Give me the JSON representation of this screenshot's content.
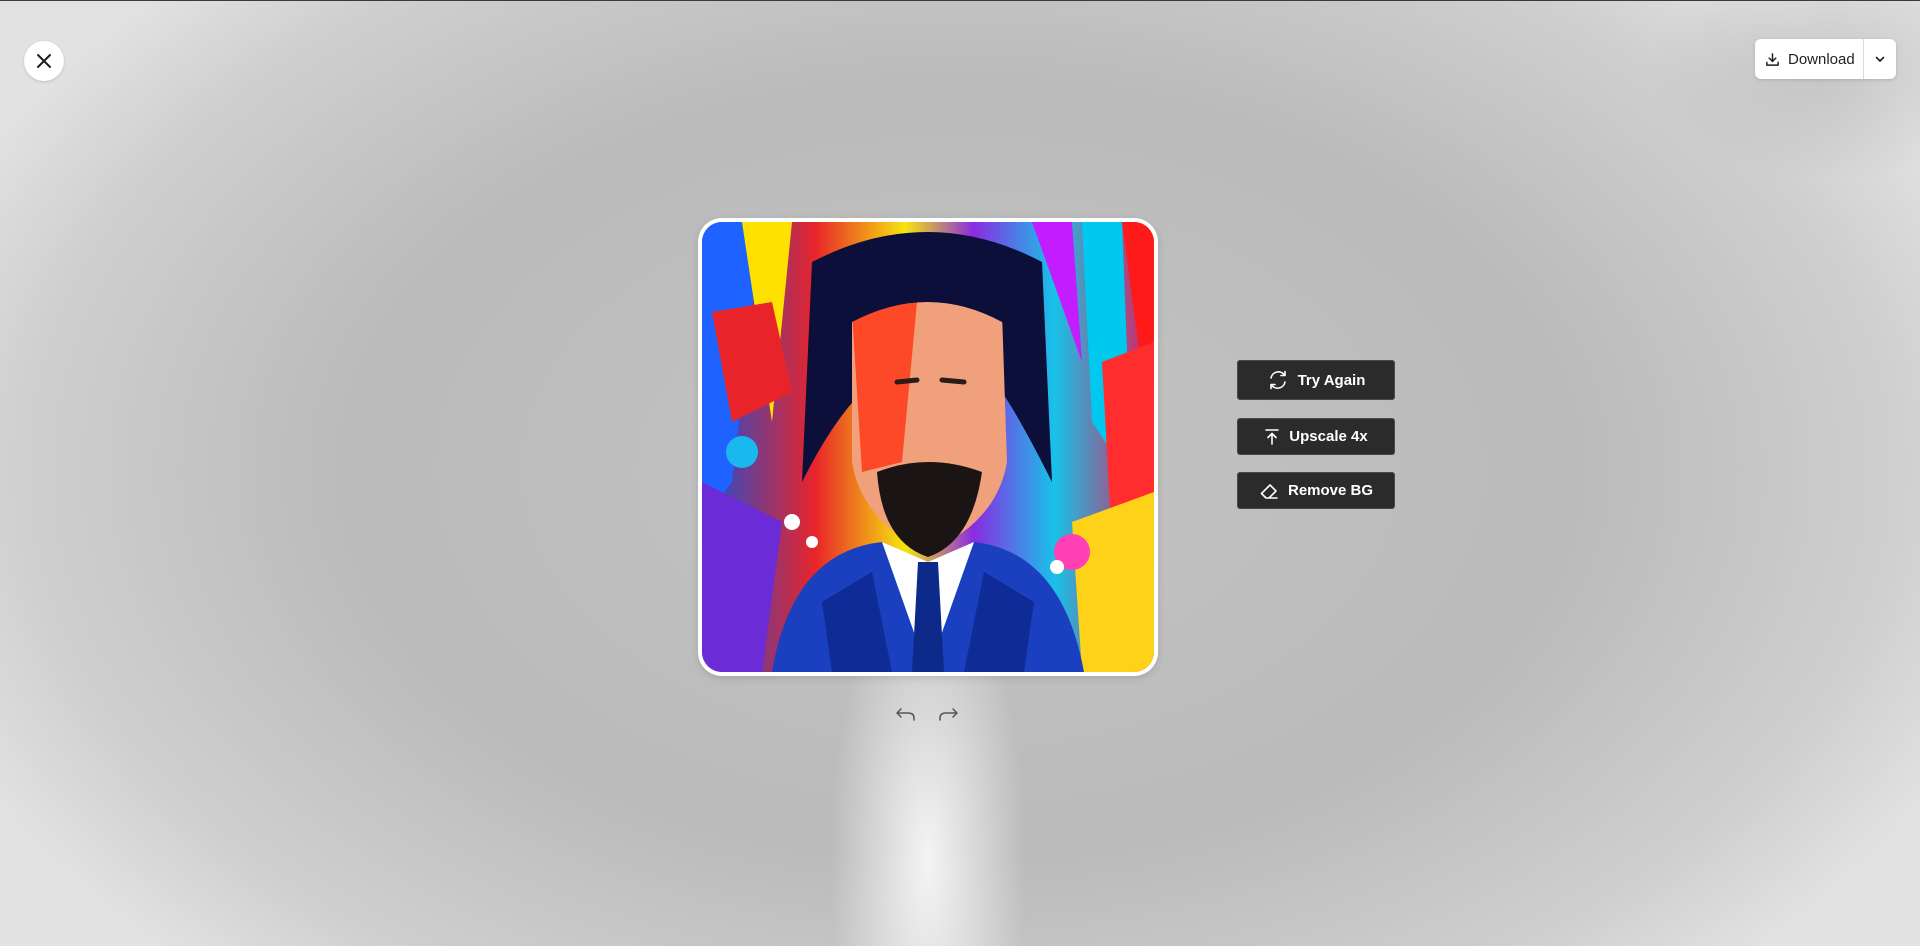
{
  "toolbar": {
    "close_icon": "close-icon",
    "download_label": "Download",
    "download_icon": "download-icon",
    "dropdown_icon": "chevron-down-icon"
  },
  "history": {
    "undo_icon": "undo-icon",
    "redo_icon": "redo-icon"
  },
  "actions": [
    {
      "label": "Try Again",
      "icon": "refresh-icon"
    },
    {
      "label": "Upscale 4x",
      "icon": "upscale-icon"
    },
    {
      "label": "Remove BG",
      "icon": "eraser-icon"
    }
  ],
  "colors": {
    "action_bg": "#2b2b2b",
    "action_text": "#ffffff",
    "backdrop": "#bababa"
  }
}
